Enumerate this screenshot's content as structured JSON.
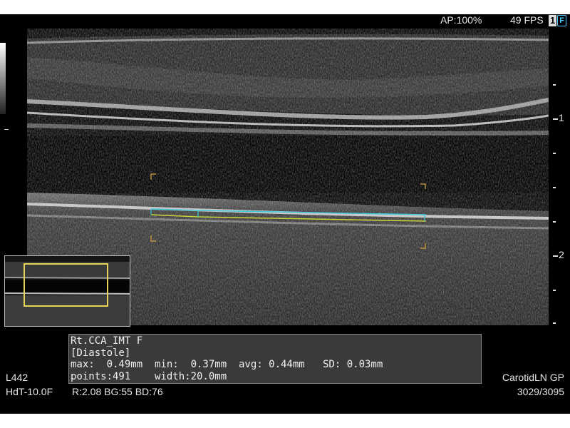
{
  "header": {
    "acoustic_power": "AP:100%",
    "frame_rate": "49 FPS",
    "frame_badge_number": "1",
    "frame_badge_letter": "F"
  },
  "depth_scale": {
    "labels": [
      "1",
      "2"
    ]
  },
  "measurement": {
    "title": "Rt.CCA_IMT F",
    "phase": "[Diastole]",
    "stats_line": "max:  0.49mm  min:  0.37mm  avg: 0.44mm   SD: 0.03mm",
    "points_line": "points:491    width:20.0mm"
  },
  "footer": {
    "probe": "L442",
    "preset_left": "HdT-10.0F",
    "params": "R:2.08 BG:55 BD:76",
    "preset": "CarotidLN GP",
    "frame_counter": "3029/3095"
  },
  "colors": {
    "trace_upper": "#3fc7d8",
    "trace_lower": "#c8d43a",
    "roi_bracket": "#d9a441",
    "thumbnail_roi": "#e8d25a"
  }
}
